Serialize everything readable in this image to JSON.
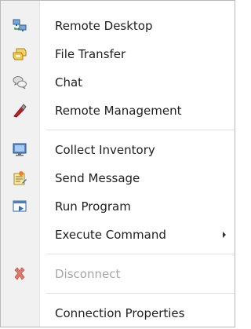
{
  "menu": {
    "items": {
      "remote_desktop": {
        "label": "Remote Desktop",
        "icon": "remote-desktop-icon"
      },
      "file_transfer": {
        "label": "File Transfer",
        "icon": "file-transfer-icon"
      },
      "chat": {
        "label": "Chat",
        "icon": "chat-icon"
      },
      "remote_management": {
        "label": "Remote Management",
        "icon": "remote-management-icon"
      },
      "collect_inventory": {
        "label": "Collect Inventory",
        "icon": "collect-inventory-icon"
      },
      "send_message": {
        "label": "Send Message",
        "icon": "send-message-icon"
      },
      "run_program": {
        "label": "Run Program",
        "icon": "run-program-icon"
      },
      "execute_command": {
        "label": "Execute Command",
        "icon": "",
        "has_submenu": true
      },
      "disconnect": {
        "label": "Disconnect",
        "icon": "disconnect-icon",
        "disabled": true
      },
      "connection_properties": {
        "label": "Connection Properties",
        "icon": ""
      }
    }
  },
  "colors": {
    "gutter": "#f1f1f1",
    "border": "#b9b9b9",
    "separator": "#e1e1e1",
    "text": "#1e1e1e",
    "disabled_text": "#a6a6a6"
  }
}
